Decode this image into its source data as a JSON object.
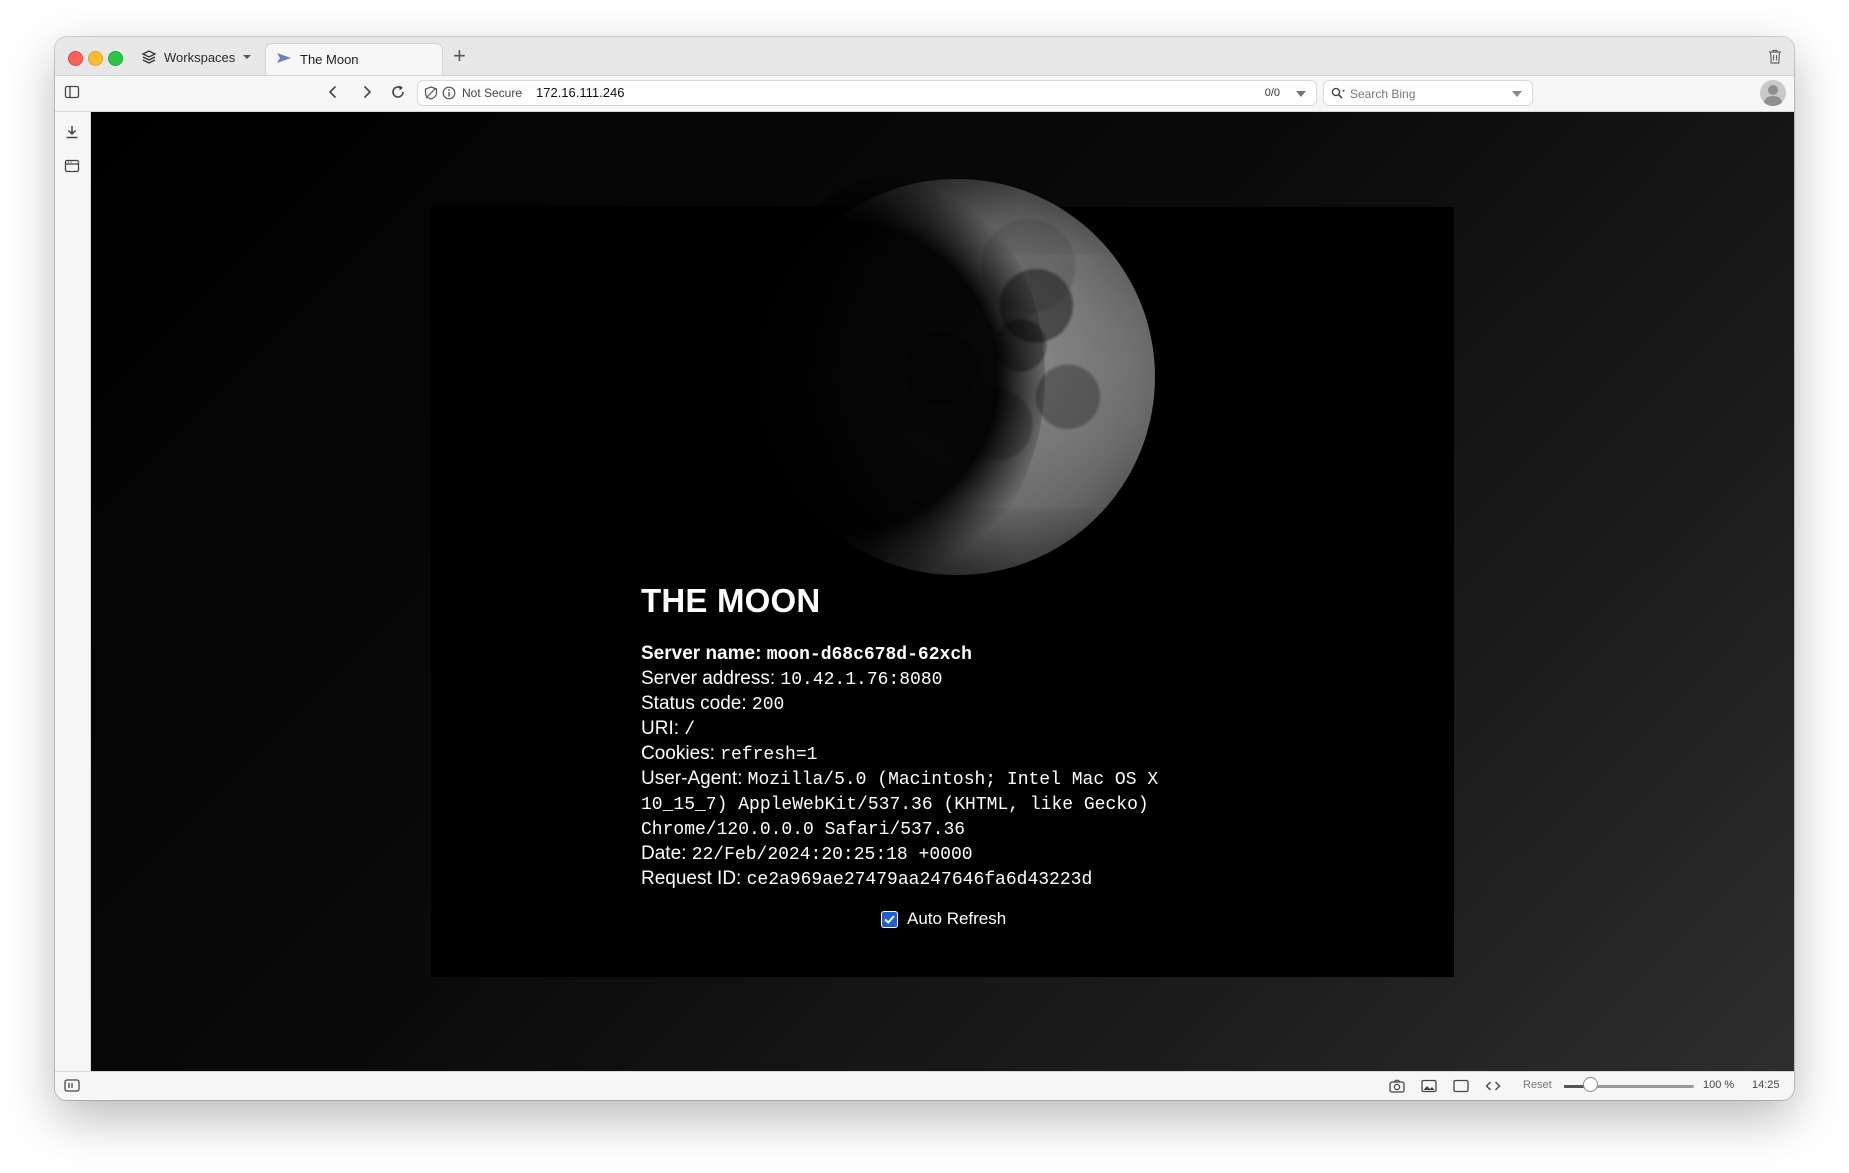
{
  "browser": {
    "workspaces_label": "Workspaces",
    "tab_title": "The Moon",
    "new_tab": "+",
    "security_label": "Not Secure",
    "url": "172.16.111.246",
    "match_count": "0/0",
    "search_placeholder": "Search Bing"
  },
  "page": {
    "title": "THE MOON",
    "fields": [
      {
        "key": "Server name: ",
        "value": "moon-d68c678d-62xch"
      },
      {
        "key": "Server address: ",
        "value": "10.42.1.76:8080"
      },
      {
        "key": "Status code: ",
        "value": "200"
      },
      {
        "key": "URI: ",
        "value": "/"
      },
      {
        "key": "Cookies: ",
        "value": "refresh=1"
      },
      {
        "key": "User-Agent: ",
        "value": "Mozilla/5.0 (Macintosh; Intel Mac OS X",
        "cont1": "10_15_7) AppleWebKit/537.36 (KHTML, like Gecko)",
        "cont2": "Chrome/120.0.0.0 Safari/537.36"
      },
      {
        "key": "Date: ",
        "value": "22/Feb/2024:20:25:18 +0000"
      },
      {
        "key": "Request ID: ",
        "value": "ce2a969ae27479aa247646fa6d43223d"
      }
    ],
    "auto_refresh_label": "Auto Refresh",
    "auto_refresh_checked": true
  },
  "statusbar": {
    "reset_label": "Reset",
    "zoom_percent": 100,
    "zoom_label": "100 %",
    "clock": "14:25"
  },
  "colors": {
    "page_background": "#000000",
    "text": "#ffffff",
    "checkbox_accent": "#1a5fd6"
  }
}
